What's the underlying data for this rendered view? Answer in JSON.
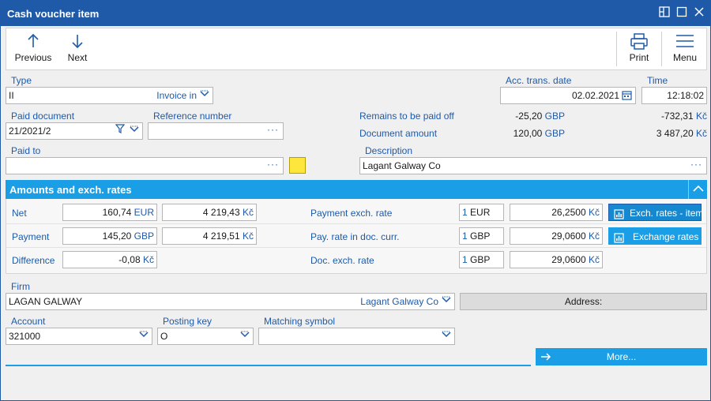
{
  "window": {
    "title": "Cash voucher item"
  },
  "toolbar": {
    "previous": "Previous",
    "next": "Next",
    "print": "Print",
    "menu": "Menu"
  },
  "header": {
    "type_label": "Type",
    "type_value": "II",
    "type_selected": "Invoice in",
    "acc_date_label": "Acc. trans. date",
    "acc_date_value": "02.02.2021",
    "time_label": "Time",
    "time_value": "12:18:02",
    "paid_document_label": "Paid document",
    "paid_document_value": "21/2021/2",
    "reference_label": "Reference number",
    "reference_value": "",
    "paid_to_label": "Paid to",
    "paid_to_value": "",
    "description_label": "Description",
    "description_value": "Lagant Galway Co",
    "remains_label": "Remains to be paid off",
    "remains_foreign": "-25,20",
    "remains_foreign_cur": "GBP",
    "remains_local": "-732,31",
    "remains_local_cur": "Kč",
    "doc_amount_label": "Document amount",
    "doc_amount_foreign": "120,00",
    "doc_amount_foreign_cur": "GBP",
    "doc_amount_local": "3 487,20",
    "doc_amount_local_cur": "Kč"
  },
  "amounts": {
    "section_title": "Amounts and exch. rates",
    "net_label": "Net",
    "net_foreign": "160,74",
    "net_foreign_cur": "EUR",
    "net_local": "4 219,43",
    "net_local_cur": "Kč",
    "payment_label": "Payment",
    "payment_foreign": "145,20",
    "payment_foreign_cur": "GBP",
    "payment_local": "4 219,51",
    "payment_local_cur": "Kč",
    "difference_label": "Difference",
    "difference_local": "-0,08",
    "difference_local_cur": "Kč",
    "pay_rate_label": "Payment exch. rate",
    "pay_rate_qty": "1",
    "pay_rate_cur": "EUR",
    "pay_rate_value": "26,2500",
    "pay_rate_value_cur": "Kč",
    "pay_doc_rate_label": "Pay. rate in doc. curr.",
    "pay_doc_rate_qty": "1",
    "pay_doc_rate_cur": "GBP",
    "pay_doc_rate_value": "29,0600",
    "pay_doc_rate_value_cur": "Kč",
    "doc_rate_label": "Doc. exch. rate",
    "doc_rate_qty": "1",
    "doc_rate_cur": "GBP",
    "doc_rate_value": "29,0600",
    "doc_rate_value_cur": "Kč",
    "btn_rates_item": "Exch. rates - item",
    "btn_rates": "Exchange rates"
  },
  "firm": {
    "firm_label": "Firm",
    "firm_value": "LAGAN GALWAY",
    "firm_selected": "Lagant Galway Co",
    "address_button": "Address:",
    "account_label": "Account",
    "account_value": "321000",
    "posting_key_label": "Posting key",
    "posting_key_value": "O",
    "matching_label": "Matching symbol",
    "matching_value": "",
    "more_button": "More..."
  },
  "colors": {
    "titlebar": "#1e5aa8",
    "accent": "#1a9ee6",
    "link": "#1e5aa8",
    "swatch": "#ffe63c"
  }
}
